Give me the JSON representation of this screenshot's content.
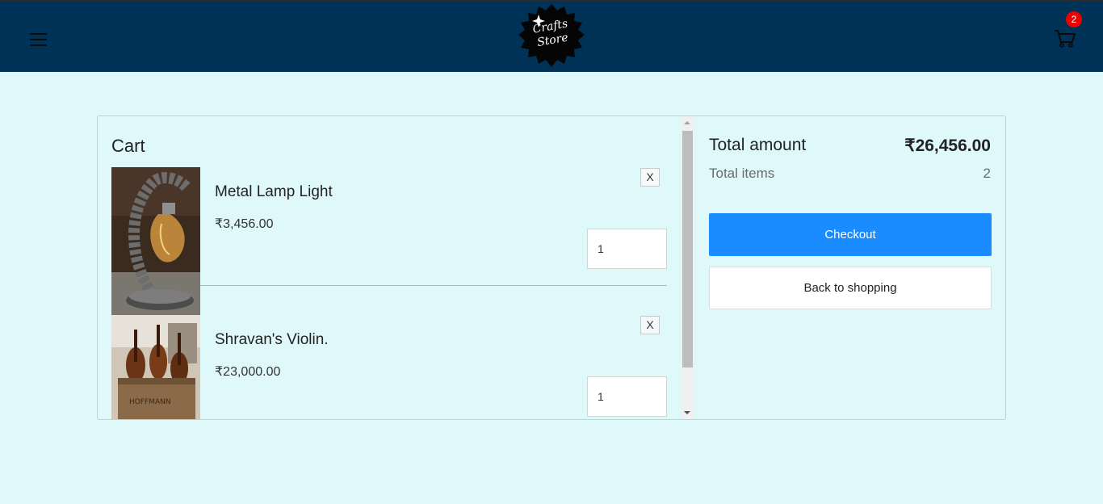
{
  "header": {
    "logo_line1": "Crafts",
    "logo_line2": "Store",
    "cart_count": "2"
  },
  "cart": {
    "title": "Cart",
    "items": [
      {
        "name": "Metal Lamp Light",
        "price": "₹3,456.00",
        "quantity": "1",
        "remove_label": "X",
        "image": "lamp-photo"
      },
      {
        "name": "Shravan's Violin.",
        "price": "₹23,000.00",
        "quantity": "1",
        "remove_label": "X",
        "image": "violins-photo"
      }
    ]
  },
  "summary": {
    "total_label": "Total amount",
    "total_value": "₹26,456.00",
    "items_label": "Total items",
    "items_value": "2",
    "checkout_label": "Checkout",
    "back_label": "Back to shopping"
  },
  "colors": {
    "header_bg": "#003157",
    "page_bg": "#dff9fb",
    "checkout_bg": "#1a8cff",
    "badge_bg": "#ee0000"
  }
}
